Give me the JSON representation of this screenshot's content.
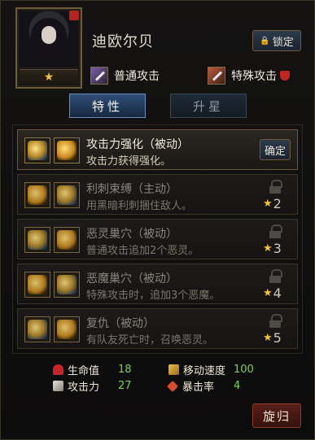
{
  "hero": {
    "name": "迪欧尔贝",
    "stars": "★",
    "lock_label": "锁定"
  },
  "attacks": {
    "normal_label": "普通攻击",
    "special_label": "特殊攻击"
  },
  "tabs": [
    {
      "label": "特性",
      "active": true
    },
    {
      "label": "升星",
      "active": false
    }
  ],
  "skills": [
    {
      "title": "攻击力强化（被动）",
      "desc": "攻击力获得强化。",
      "locked": false,
      "action": "确定",
      "icon_left": "slash-icon",
      "icon_right": "sword-icon"
    },
    {
      "title": "利刺束缚（主动）",
      "desc": "用黑暗利刺捆住敌人。",
      "locked": true,
      "req": "2",
      "icon_left": "thorn-bind-icon",
      "icon_right": "thorn-icon"
    },
    {
      "title": "恶灵巢穴（被动）",
      "desc": "普通攻击追加2个恶灵。",
      "locked": true,
      "req": "3",
      "icon_left": "claw-icon",
      "icon_right": "spirit-nest-icon"
    },
    {
      "title": "恶魔巢穴（被动）",
      "desc": "特殊攻击时，追加3个恶魔。",
      "locked": true,
      "req": "4",
      "icon_left": "demon-burst-icon",
      "icon_right": "demon-nest-icon"
    },
    {
      "title": "复仇（被动）",
      "desc": "有队友死亡时，召唤恶灵。",
      "locked": true,
      "req": "5",
      "icon_left": "mask-icon",
      "icon_right": "vortex-icon"
    }
  ],
  "stats": {
    "hp_label": "生命值",
    "hp_value": "18",
    "atk_label": "攻击力",
    "atk_value": "27",
    "speed_label": "移动速度",
    "speed_value": "100",
    "crit_label": "暴击率",
    "crit_value": "4"
  },
  "back_label": "旋归",
  "colors": {
    "accent_gold": "#f2c23a",
    "stat_green": "#7ed24c",
    "tab_blue": "#2e4e78"
  }
}
